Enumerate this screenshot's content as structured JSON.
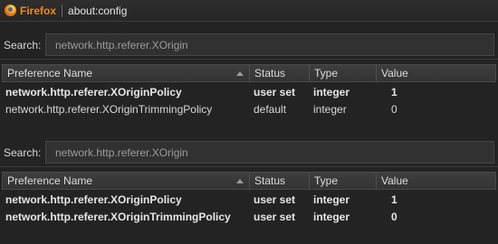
{
  "titlebar": {
    "brand": "Firefox",
    "url": "about:config"
  },
  "panels": [
    {
      "search_label": "Search:",
      "search_value": "network.http.referer.XOrigin",
      "columns": [
        "Preference Name",
        "Status",
        "Type",
        "Value"
      ],
      "rows": [
        {
          "name": "network.http.referer.XOriginPolicy",
          "status": "user set",
          "type": "integer",
          "value": "1",
          "bold": true
        },
        {
          "name": "network.http.referer.XOriginTrimmingPolicy",
          "status": "default",
          "type": "integer",
          "value": "0",
          "bold": false
        }
      ]
    },
    {
      "search_label": "Search:",
      "search_value": "network.http.referer.XOrigin",
      "columns": [
        "Preference Name",
        "Status",
        "Type",
        "Value"
      ],
      "rows": [
        {
          "name": "network.http.referer.XOriginPolicy",
          "status": "user set",
          "type": "integer",
          "value": "1",
          "bold": true
        },
        {
          "name": "network.http.referer.XOriginTrimmingPolicy",
          "status": "user set",
          "type": "integer",
          "value": "0",
          "bold": true
        }
      ]
    }
  ]
}
